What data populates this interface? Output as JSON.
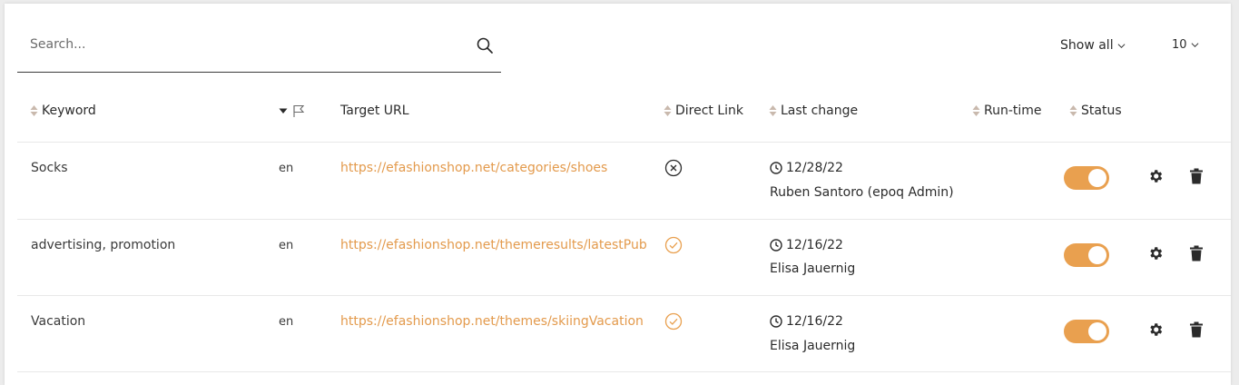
{
  "search": {
    "placeholder": "Search...",
    "value": ""
  },
  "filters": {
    "show_all_label": "Show all",
    "per_page_label": "10"
  },
  "columns": {
    "keyword": "Keyword",
    "target_url": "Target URL",
    "direct_link": "Direct Link",
    "last_change": "Last change",
    "run_time": "Run-time",
    "status": "Status"
  },
  "rows": [
    {
      "keyword": "Socks",
      "lang": "en",
      "url": "https://efashionshop.net/categories/shoes",
      "direct_link": false,
      "date": "12/28/22",
      "user": "Ruben Santoro (epoq Admin)",
      "status_on": true
    },
    {
      "keyword": "advertising, promotion",
      "lang": "en",
      "url": "https://efashionshop.net/themeresults/latestPub",
      "direct_link": true,
      "date": "12/16/22",
      "user": "Elisa Jauernig",
      "status_on": true
    },
    {
      "keyword": "Vacation",
      "lang": "en",
      "url": "https://efashionshop.net/themes/skiingVacation",
      "direct_link": true,
      "date": "12/16/22",
      "user": "Elisa Jauernig",
      "status_on": true
    }
  ],
  "colors": {
    "accent": "#e9a04f",
    "link": "#e39a4c",
    "text": "#2b2b2b"
  }
}
